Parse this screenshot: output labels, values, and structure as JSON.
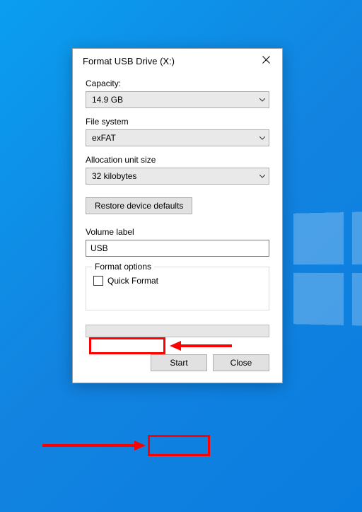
{
  "dialog": {
    "title": "Format USB Drive (X:)",
    "capacity_label": "Capacity:",
    "capacity_value": "14.9 GB",
    "filesystem_label": "File system",
    "filesystem_value": "exFAT",
    "allocation_label": "Allocation unit size",
    "allocation_value": "32 kilobytes",
    "restore_label": "Restore device defaults",
    "volume_label_label": "Volume label",
    "volume_label_value": "USB",
    "format_options_label": "Format options",
    "quick_format_label": "Quick Format",
    "quick_format_checked": false,
    "start_label": "Start",
    "close_label": "Close"
  },
  "annotations": {
    "highlight_quick_format": true,
    "highlight_start": true
  }
}
